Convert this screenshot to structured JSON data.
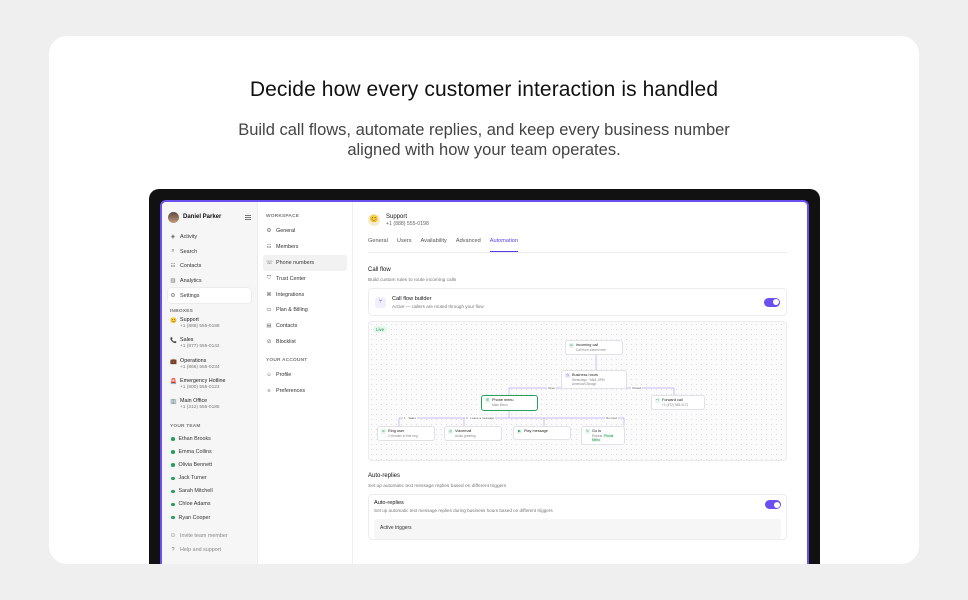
{
  "hero": {
    "title": "Decide how every customer interaction is handled",
    "subtitle": "Build call flows, automate replies, and keep every business number aligned with how your team operates."
  },
  "app": {
    "user": "Daniel Parker",
    "nav": [
      {
        "icon": "activity-icon",
        "glyph": "◈",
        "label": "Activity"
      },
      {
        "icon": "search-icon",
        "glyph": "⌕",
        "label": "Search"
      },
      {
        "icon": "contacts-icon",
        "glyph": "☷",
        "label": "Contacts"
      },
      {
        "icon": "analytics-icon",
        "glyph": "▥",
        "label": "Analytics"
      },
      {
        "icon": "settings-icon",
        "glyph": "⚙",
        "label": "Settings"
      }
    ],
    "inboxes_label": "Inboxes",
    "inboxes": [
      {
        "glyph": "😊",
        "name": "Support",
        "number": "+1 (888) 555-0198"
      },
      {
        "glyph": "📞",
        "name": "Sales",
        "number": "+1 (877) 555-0142"
      },
      {
        "glyph": "💼",
        "name": "Operations",
        "number": "+1 (866) 555-0234"
      },
      {
        "glyph": "🚨",
        "name": "Emergency Hotline",
        "number": "+1 (800) 555-0123"
      },
      {
        "glyph": "🏢",
        "name": "Main Office",
        "number": "+1 (312) 555-0185"
      }
    ],
    "team_label": "Your team",
    "team": [
      "Ethan Brooks",
      "Emma Collins",
      "Olivia Bennett",
      "Jack Turner",
      "Sarah Mitchell",
      "Chloe Adams",
      "Ryan Cooper"
    ],
    "invite": "Invite team member",
    "help": "Help and support",
    "workspace_label": "Workspace",
    "workspace": [
      {
        "glyph": "⚙",
        "label": "General"
      },
      {
        "glyph": "☷",
        "label": "Members"
      },
      {
        "glyph": "☏",
        "label": "Phone numbers"
      },
      {
        "glyph": "⛉",
        "label": "Trust Center"
      },
      {
        "glyph": "⌘",
        "label": "Integrations"
      },
      {
        "glyph": "▭",
        "label": "Plan & Billing"
      },
      {
        "glyph": "▤",
        "label": "Contacts"
      },
      {
        "glyph": "⊘",
        "label": "Blocklist"
      }
    ],
    "account_label": "Your account",
    "account": [
      {
        "glyph": "☺",
        "label": "Profile"
      },
      {
        "glyph": "≡",
        "label": "Preferences"
      }
    ],
    "header": {
      "emoji": "😊",
      "name": "Support",
      "number": "+1 (888) 555-0198"
    },
    "tabs": [
      "General",
      "Users",
      "Availability",
      "Advanced",
      "Automation"
    ],
    "active_tab": "Automation",
    "call_flow": {
      "title": "Call flow",
      "subtitle": "Build custom rules to route incoming calls",
      "builder_title": "Call flow builder",
      "builder_sub": "Active — callers are routed through your flow",
      "live": "Live"
    },
    "flow": {
      "incoming": {
        "title": "Incoming call",
        "sub": "Call from clients here"
      },
      "hours": {
        "title": "Business hours",
        "sub": "Weekdays · 9AM–5PM · America/Chicago"
      },
      "open": "Open",
      "closed": "Closed",
      "menu": {
        "title": "Phone menu",
        "sub": "Main Menu"
      },
      "forward": {
        "title": "Forward call",
        "sub": "+1 (872) 555-0172"
      },
      "k1": "1 · Sales",
      "k2": "2 · Leave a message",
      "k3": "No input",
      "ring": {
        "title": "Ring user",
        "sub": "2 minutes to first ring"
      },
      "voicemail": {
        "title": "Voicemail",
        "sub": "Audio greeting"
      },
      "play": {
        "title": "Play message"
      },
      "goto": {
        "title": "Go to",
        "sub": "Repeat",
        "pill": "Phone Menu"
      }
    },
    "auto": {
      "title": "Auto-replies",
      "subtitle": "Set up automatic text message replies based on different triggers",
      "card_title": "Auto-replies",
      "card_sub": "Set up automatic text message replies during business hours based on different triggers",
      "triggers": "Active triggers"
    },
    "accent": "#6c4ff0"
  }
}
